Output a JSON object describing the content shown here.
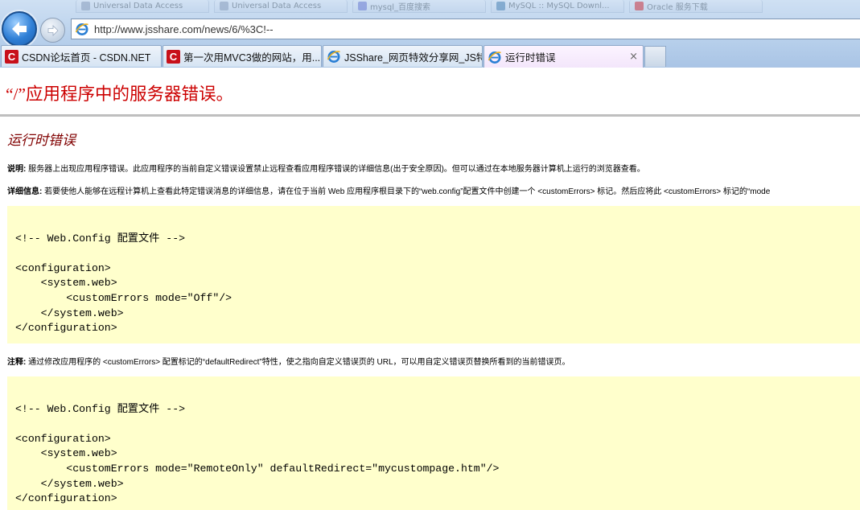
{
  "browser": {
    "background_tabs": [
      {
        "label": "Universal Data Access"
      },
      {
        "label": "Universal Data Access"
      },
      {
        "label": "mysql_百度搜索"
      },
      {
        "label": "MySQL :: MySQL Downl..."
      },
      {
        "label": "Oracle 服务下载"
      }
    ],
    "address": {
      "url": "http://www.jsshare.com/news/6/%3C!--"
    },
    "tabs": [
      {
        "label": "CSDN论坛首页 - CSDN.NET",
        "icon": "csdn-icon",
        "active": false
      },
      {
        "label": "第一次用MVC3做的网站，用...",
        "icon": "csdn-icon",
        "active": false
      },
      {
        "label": "JSShare_网页特效分享网_JS特...",
        "icon": "ie-icon",
        "active": false
      },
      {
        "label": "运行时错误",
        "icon": "ie-icon",
        "active": true,
        "close": "×"
      }
    ],
    "icon_letters": {
      "csdn": "C"
    },
    "colors": {
      "accent": "#3b7fd0",
      "csdn_red": "#c8101a"
    }
  },
  "page": {
    "title": "“/”应用程序中的服务器错误。",
    "subtitle": "运行时错误",
    "description": {
      "label": "说明:",
      "text": " 服务器上出现应用程序错误。此应用程序的当前自定义错误设置禁止远程查看应用程序错误的详细信息(出于安全原因)。但可以通过在本地服务器计算机上运行的浏览器查看。"
    },
    "details": {
      "label": "详细信息:",
      "text": " 若要使他人能够在远程计算机上查看此特定错误消息的详细信息，请在位于当前 Web 应用程序根目录下的“web.config”配置文件中创建一个 <customErrors> 标记。然后应将此 <customErrors> 标记的“mode"
    },
    "code1": "\n<!-- Web.Config 配置文件 -->\n\n<configuration>\n    <system.web>\n        <customErrors mode=\"Off\"/>\n    </system.web>\n</configuration>",
    "note": {
      "label": "注释:",
      "text": " 通过修改应用程序的 <customErrors> 配置标记的“defaultRedirect”特性，使之指向自定义错误页的 URL，可以用自定义错误页替换所看到的当前错误页。"
    },
    "code2": "\n<!-- Web.Config 配置文件 -->\n\n<configuration>\n    <system.web>\n        <customErrors mode=\"RemoteOnly\" defaultRedirect=\"mycustompage.htm\"/>\n    </system.web>\n</configuration>",
    "colors": {
      "title": "#cc0000",
      "subtitle": "#800000",
      "code_bg": "#ffffcc"
    }
  }
}
